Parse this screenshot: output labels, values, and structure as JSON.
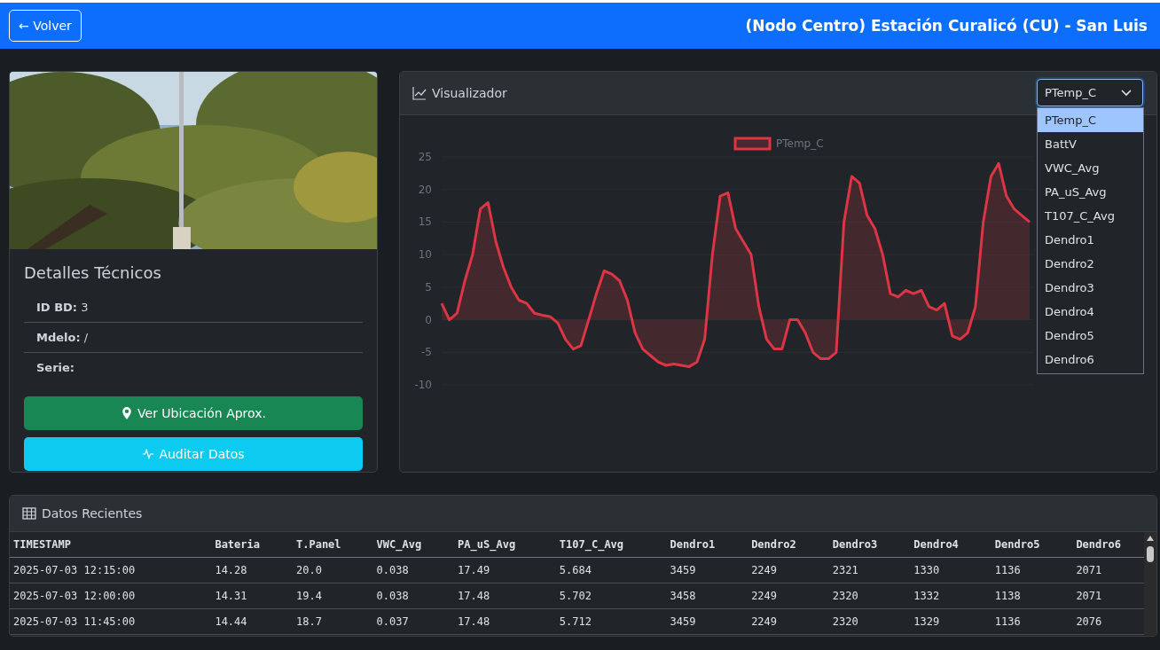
{
  "header": {
    "back_button": "← Volver",
    "title": "(Nodo Centro) Estación Curalicó (CU) - San Luis"
  },
  "station_card": {
    "title": "Detalles Técnicos",
    "details": [
      {
        "label": "ID BD:",
        "value": "3"
      },
      {
        "label": "Mdelo:",
        "value": "/"
      },
      {
        "label": "Serie:"
      }
    ],
    "buttons": [
      {
        "label": "Ver Ubicación Aprox.",
        "kind": "location"
      },
      {
        "label": "Auditar Datos",
        "kind": "audit"
      }
    ]
  },
  "visualizer": {
    "title": "Visualizador",
    "select": {
      "value": "PTemp_C",
      "expanded": true,
      "options": [
        {
          "label": "PTemp_C",
          "selected": true
        },
        {
          "label": "BattV",
          "selected": false
        },
        {
          "label": "VWC_Avg",
          "selected": false
        },
        {
          "label": "PA_uS_Avg",
          "selected": false
        },
        {
          "label": "T107_C_Avg",
          "selected": false
        },
        {
          "label": "Dendro1",
          "selected": false
        },
        {
          "label": "Dendro2",
          "selected": false
        },
        {
          "label": "Dendro3",
          "selected": false
        },
        {
          "label": "Dendro4",
          "selected": false
        },
        {
          "label": "Dendro5",
          "selected": false
        },
        {
          "label": "Dendro6",
          "selected": false
        }
      ]
    },
    "chart_data": {
      "type": "area",
      "grid": true,
      "ylim": [
        -10,
        25
      ],
      "yticks": [
        -10,
        -5,
        0,
        5,
        10,
        15,
        20,
        25
      ],
      "series": [
        {
          "name": "PTemp_C",
          "color": "#dc3545",
          "values": [
            2.5,
            0,
            1,
            6,
            10,
            17,
            18,
            12,
            8,
            5,
            3,
            2.5,
            1,
            0.7,
            0.5,
            -0.5,
            -3,
            -4.5,
            -4,
            0,
            4,
            7.5,
            7,
            6,
            3,
            -2,
            -4.5,
            -5.5,
            -6.5,
            -7,
            -6.8,
            -7,
            -7.2,
            -6.5,
            -3,
            10,
            19,
            19.5,
            14,
            12,
            10,
            2,
            -3,
            -4.5,
            -4.5,
            0,
            0,
            -2,
            -5,
            -6,
            -6,
            -5,
            15,
            22,
            21,
            16,
            14,
            10,
            4,
            3.5,
            4.5,
            4,
            4.5,
            2,
            1.5,
            2.5,
            -2.5,
            -3,
            -2,
            2,
            15,
            22,
            24,
            19,
            17,
            16,
            15
          ]
        }
      ]
    }
  },
  "recent_data": {
    "title": "Datos Recientes",
    "columns": [
      "TIMESTAMP",
      "Bateria",
      "T.Panel",
      "VWC_Avg",
      "PA_uS_Avg",
      "T107_C_Avg",
      "Dendro1",
      "Dendro2",
      "Dendro3",
      "Dendro4",
      "Dendro5",
      "Dendro6"
    ],
    "rows": [
      [
        "2025-07-03 12:15:00",
        "14.28",
        "20.0",
        "0.038",
        "17.49",
        "5.684",
        "3459",
        "2249",
        "2321",
        "1330",
        "1136",
        "2071"
      ],
      [
        "2025-07-03 12:00:00",
        "14.31",
        "19.4",
        "0.038",
        "17.48",
        "5.702",
        "3458",
        "2249",
        "2320",
        "1332",
        "1138",
        "2071"
      ],
      [
        "2025-07-03 11:45:00",
        "14.44",
        "18.7",
        "0.037",
        "17.48",
        "5.712",
        "3459",
        "2249",
        "2320",
        "1329",
        "1136",
        "2076"
      ]
    ]
  }
}
